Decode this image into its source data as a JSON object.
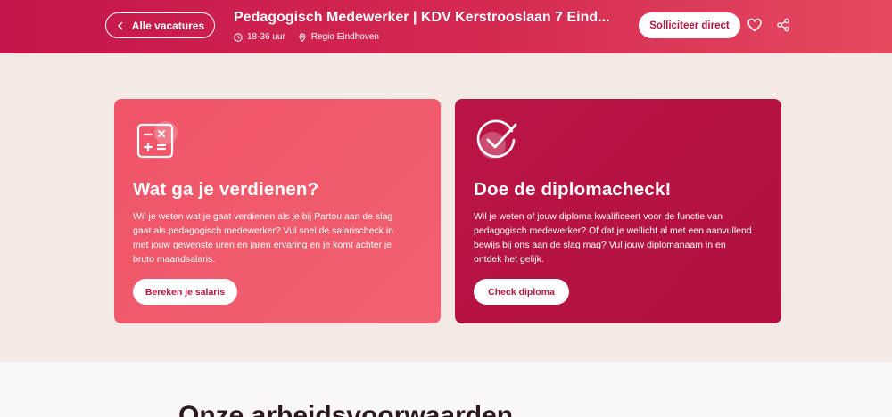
{
  "header": {
    "back_label": "Alle vacatures",
    "job_title": "Pedagogisch Medewerker | KDV Kerstrooslaan 7 Eind...",
    "hours": "18-36 uur",
    "location": "Regio Eindhoven",
    "apply_label": "Solliciteer direct",
    "icons": [
      "chevron-left-icon",
      "clock-icon",
      "location-pin-icon",
      "heart-icon",
      "share-icon"
    ]
  },
  "cards": {
    "salary": {
      "icon": "calculator-icon",
      "title": "Wat ga je verdienen?",
      "text": "Wil je weten wat je gaat verdienen als je bij Partou aan de slag gaat als pedagogisch medewerker? Vul snel de salarischeck in met jouw gewenste uren en jaren ervaring en je komt achter je bruto maandsalaris.",
      "button_label": "Bereken je salaris",
      "color": "#f05669"
    },
    "diploma": {
      "icon": "checkmark-circle-icon",
      "title": "Doe de diplomacheck!",
      "text": "Wil je weten of jouw diploma kwalificeert voor de functie van pedagogisch medewerker? Of dat je wellicht al met een aanvullend bewijs bij ons aan de slag mag? Vul jouw diplomanaam in en ontdek het gelijk.",
      "button_label": "Check diploma",
      "color": "#b8143f"
    }
  },
  "section": {
    "heading": "Onze arbeidsvoorwaarden"
  },
  "colors": {
    "brand": "#c4164a",
    "page_background": "#f3e9e5"
  }
}
